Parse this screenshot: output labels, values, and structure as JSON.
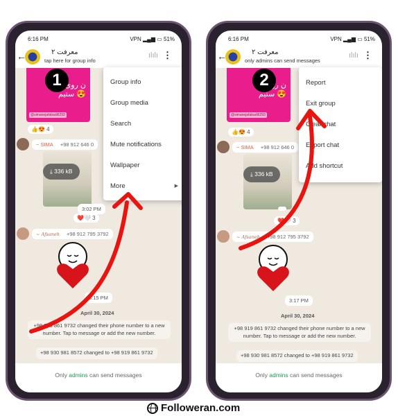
{
  "phones": [
    {
      "status": {
        "time": "6:16 PM",
        "icons": "▪ ● ● ···",
        "right": "VPN ▂▄▆ ▭ 51%"
      },
      "header": {
        "group_name": "معرفت ۲",
        "subtitle": "tap here for group info"
      },
      "badge": "1",
      "chat": {
        "pink_text": "ن روی ما\nستیم 😍",
        "pink_tag": "@simanejafabadi6293",
        "reaction1": "👍😍 4",
        "sender1": "~ SIMA",
        "sender1_phone": "+98 912 646 0",
        "file_size": "336 kB",
        "time1": "3:02 PM",
        "reaction2": "❤️🤍 3",
        "sender2": "~ Afsaneh",
        "sender2_phone": "+98 912 795 3792",
        "time2": "3:15 PM",
        "date": "April 30, 2024",
        "sys1": "+98 919 861 9732 changed their phone number to a new number. Tap to message or add the new number.",
        "sys2": "+98 930 981 8572 changed to +98 919 861 9732"
      },
      "bottom": {
        "pre": "Only ",
        "link": "admins",
        "post": " can send messages"
      },
      "menu": [
        "Group info",
        "Group media",
        "Search",
        "Mute notifications",
        "Wallpaper",
        "More"
      ]
    },
    {
      "status": {
        "time": "6:16 PM",
        "icons": "▪ ● ● ···",
        "right": "VPN ▂▄▆ ▭ 51%"
      },
      "header": {
        "group_name": "معرفت ۲",
        "subtitle": "only admins can send messages"
      },
      "badge": "2",
      "chat": {
        "pink_text": "ن روی ما\nستیم 😍",
        "pink_tag": "@simanejafabadi6293",
        "reaction1": "👍😍 4",
        "sender1": "~ SIMA",
        "sender1_phone": "+98 912 646 0",
        "file_size": "336 kB",
        "time1": "",
        "reaction2": "❤️🤍 3",
        "sender2": "~ Afsaneh",
        "sender2_phone": "+98 912 795 3792",
        "time2": "3:17 PM",
        "date": "April 30, 2024",
        "sys1": "+98 919 861 9732 changed their phone number to a new number. Tap to message or add the new number.",
        "sys2": "+98 930 981 8572 changed to +98 919 861 9732"
      },
      "bottom": {
        "pre": "Only ",
        "link": "admins",
        "post": " can send messages"
      },
      "menu": [
        "Report",
        "Exit group",
        "Clear chat",
        "Export chat",
        "Add shortcut"
      ]
    }
  ],
  "arrow_color": "#e8140f",
  "footer": {
    "brand": "Followeran.com"
  }
}
